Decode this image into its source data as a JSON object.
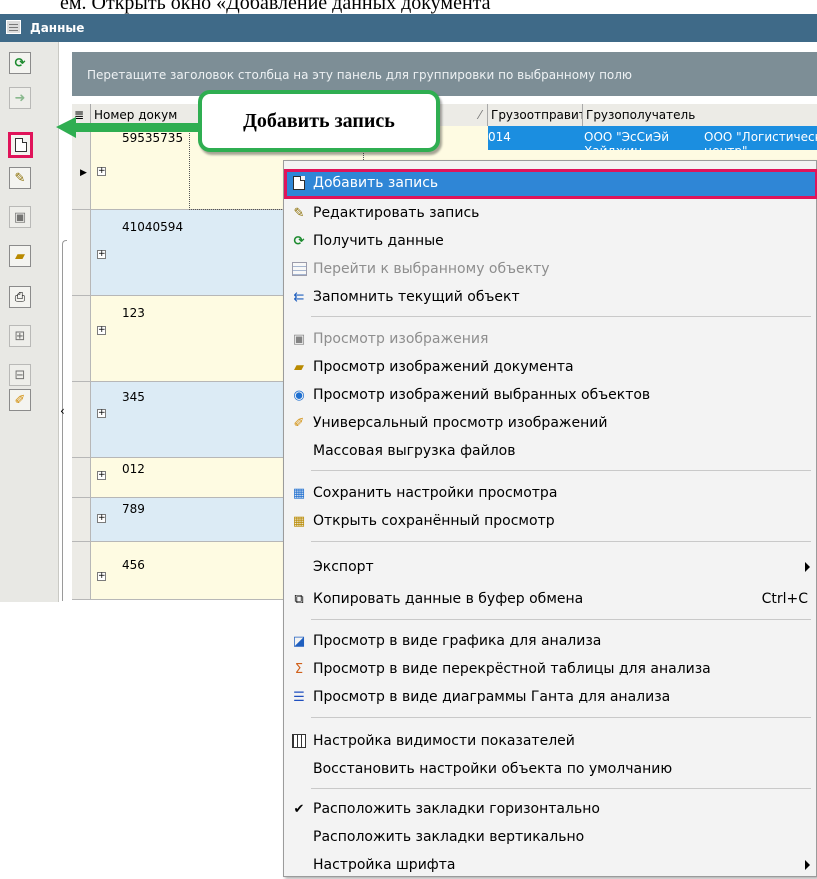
{
  "doc_heading": "ём. Открыть окно «Добавление данных документа",
  "window": {
    "title": "Данные"
  },
  "toolbar": {
    "buttons": [
      {
        "icon": "refresh-icon"
      },
      {
        "icon": "goto-icon"
      },
      {
        "icon": "add-record-icon"
      },
      {
        "icon": "edit-record-icon"
      },
      {
        "icon": "view-image-icon"
      },
      {
        "icon": "view-doc-images-icon"
      },
      {
        "icon": "print-icon"
      },
      {
        "icon": "expand-icon"
      },
      {
        "icon": "collapse-icon"
      },
      {
        "icon": "universal-view-icon"
      }
    ]
  },
  "grid": {
    "group_panel_hint": "Перетащите заголовок столбца на эту панель для группировки по выбранному полю",
    "columns": [
      "Номер докум",
      "Грузоотправите",
      "Грузополучатель"
    ],
    "rows": [
      {
        "number": "59535735",
        "date": "014",
        "shipper": "ООО \"ЭсСиЭй",
        "shipper2": "Хайджин",
        "consignee": "ООО \"Логистический",
        "consignee2": "центр\""
      },
      {
        "number": "41040594"
      },
      {
        "number": "123"
      },
      {
        "number": "345"
      },
      {
        "number": "012"
      },
      {
        "number": "789"
      },
      {
        "number": "456"
      }
    ]
  },
  "callout": {
    "text": "Добавить запись"
  },
  "menu": {
    "items": [
      {
        "label": "Добавить запись",
        "icon": "add-record-icon"
      },
      {
        "label": "Редактировать запись",
        "icon": "edit-record-icon"
      },
      {
        "label": "Получить данные",
        "icon": "refresh-icon"
      },
      {
        "label": "Перейти к выбранному объекту",
        "icon": "grid-icon"
      },
      {
        "label": "Запомнить текущий объект",
        "icon": "remember-icon"
      },
      {
        "label": "Просмотр изображения",
        "icon": "view-image-icon"
      },
      {
        "label": "Просмотр изображений документа",
        "icon": "folder-image-icon"
      },
      {
        "label": "Просмотр изображений выбранных объектов",
        "icon": "eye-icon"
      },
      {
        "label": "Универсальный просмотр изображений",
        "icon": "universal-view-icon"
      },
      {
        "label": "Массовая выгрузка файлов",
        "icon": ""
      },
      {
        "label": "Сохранить настройки просмотра",
        "icon": "save-view-icon"
      },
      {
        "label": "Открыть сохранённый просмотр",
        "icon": "open-view-icon"
      },
      {
        "label": "Экспорт",
        "icon": ""
      },
      {
        "label": "Копировать данные в буфер обмена",
        "icon": "copy-icon",
        "shortcut": "Ctrl+C"
      },
      {
        "label": "Просмотр в виде графика для анализа",
        "icon": "chart-icon"
      },
      {
        "label": "Просмотр в виде перекрёстной таблицы для анализа",
        "icon": "pivot-icon"
      },
      {
        "label": "Просмотр в виде диаграммы Ганта для анализа",
        "icon": "gantt-icon"
      },
      {
        "label": "Настройка видимости показателей",
        "icon": "columns-icon"
      },
      {
        "label": "Восстановить настройки объекта по умолчанию",
        "icon": ""
      },
      {
        "label": "Расположить закладки горизонтально",
        "icon": "check-icon"
      },
      {
        "label": "Расположить закладки вертикально",
        "icon": ""
      },
      {
        "label": "Настройка шрифта",
        "icon": ""
      }
    ]
  },
  "colors": {
    "title_bar": "#3f6a88",
    "group_panel": "#7d8e96",
    "selection": "#1b8ee0",
    "menu_highlight": "#2f86d6",
    "highlight_border": "#e0145a",
    "callout_border": "#2fae51"
  }
}
